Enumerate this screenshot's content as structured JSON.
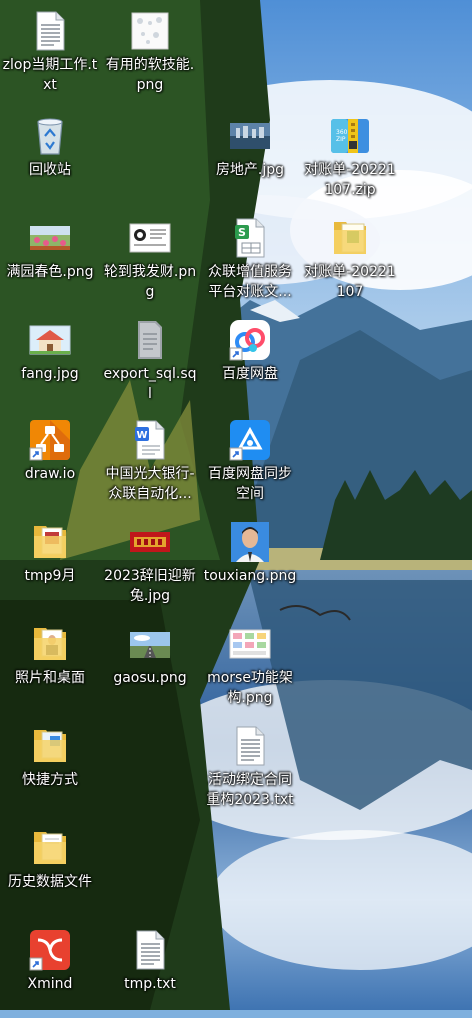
{
  "desktop": {
    "icons": [
      {
        "label": "zlop当期工作.txt",
        "icon": "text-file-icon"
      },
      {
        "label": "有用的软技能.png",
        "icon": "image-file-icon"
      },
      {
        "label": "回收站",
        "icon": "recycle-bin-icon"
      },
      {
        "label": "房地产.jpg",
        "icon": "image-file-icon"
      },
      {
        "label": "对账单-20221107.zip",
        "icon": "zip-archive-icon"
      },
      {
        "label": "满园春色.png",
        "icon": "image-file-icon"
      },
      {
        "label": "轮到我发财.png",
        "icon": "image-file-icon"
      },
      {
        "label": "众联增值服务平台对账文...",
        "icon": "spreadsheet-file-icon"
      },
      {
        "label": "对账单-20221107",
        "icon": "folder-icon"
      },
      {
        "label": "fang.jpg",
        "icon": "image-file-icon"
      },
      {
        "label": "export_sql.sql",
        "icon": "sql-file-icon"
      },
      {
        "label": "百度网盘",
        "icon": "baidu-netdisk-icon"
      },
      {
        "label": "draw.io",
        "icon": "drawio-app-icon"
      },
      {
        "label": "中国光大银行-众联自动化...",
        "icon": "word-document-icon"
      },
      {
        "label": "百度网盘同步空间",
        "icon": "baidu-sync-space-icon"
      },
      {
        "label": "tmp9月",
        "icon": "folder-icon"
      },
      {
        "label": "2023辞旧迎新兔.jpg",
        "icon": "image-file-icon"
      },
      {
        "label": "touxiang.png",
        "icon": "image-file-icon"
      },
      {
        "label": "照片和桌面",
        "icon": "folder-icon"
      },
      {
        "label": "gaosu.png",
        "icon": "image-file-icon"
      },
      {
        "label": "morse功能架构.png",
        "icon": "image-file-icon"
      },
      {
        "label": "快捷方式",
        "icon": "folder-icon"
      },
      {
        "label": "活动绑定合同重构2023.txt",
        "icon": "text-file-icon"
      },
      {
        "label": "历史数据文件",
        "icon": "folder-icon"
      },
      {
        "label": "Xmind",
        "icon": "xmind-app-icon"
      },
      {
        "label": "tmp.txt",
        "icon": "text-file-icon"
      }
    ]
  },
  "colors": {
    "sky": "#7fb0de",
    "lake": "#2f66a8",
    "mountain": "#3d6b8f",
    "forest": "#1f3b1a"
  }
}
